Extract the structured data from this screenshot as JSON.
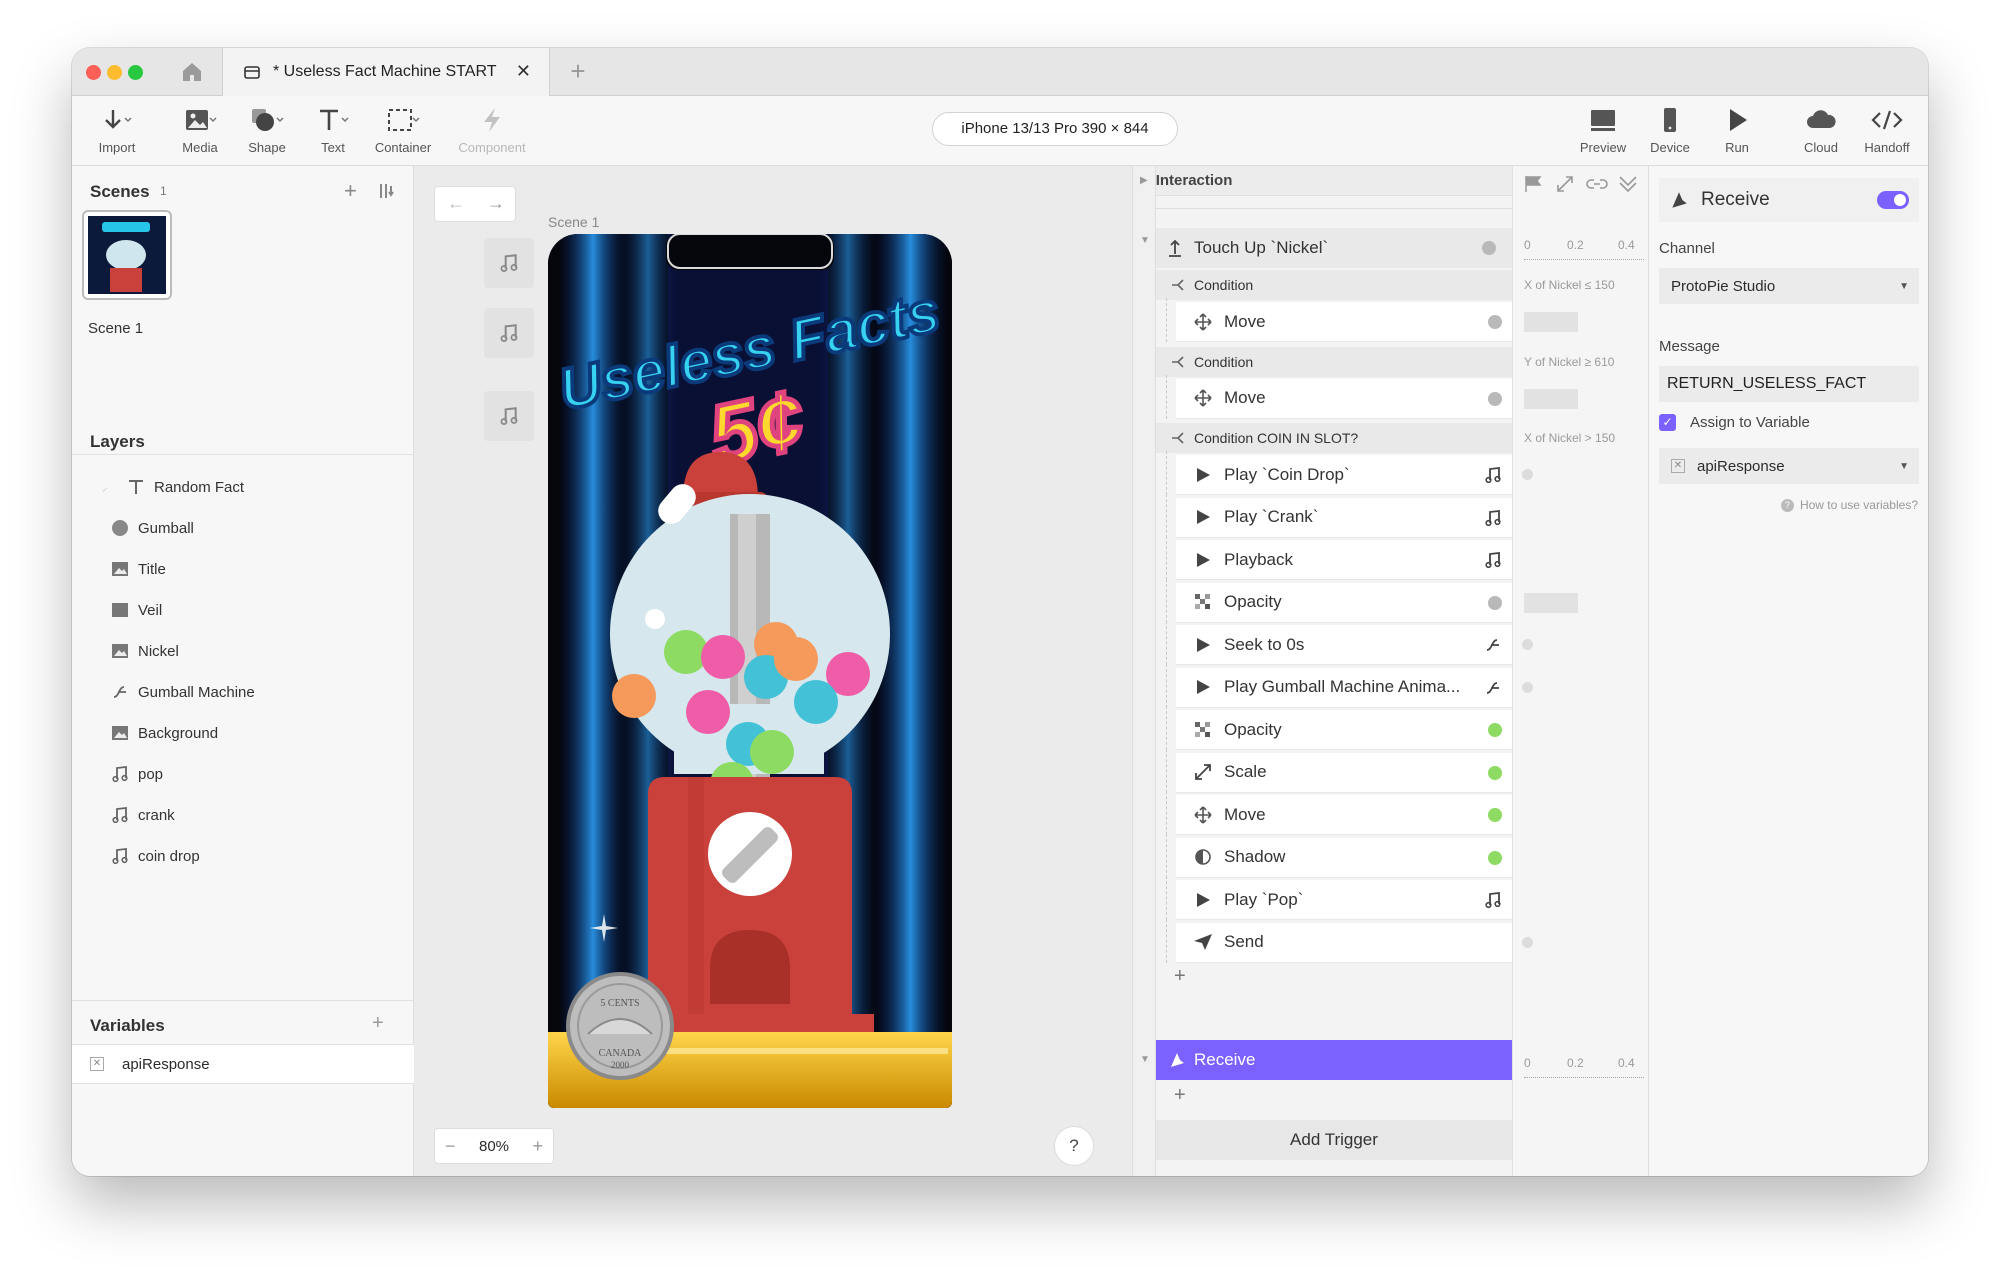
{
  "window": {
    "tab_title": "* Useless Fact Machine START",
    "traffic_lights": {
      "close": "#fe5f57",
      "minimize": "#febc2e",
      "zoom": "#28c840"
    }
  },
  "toolbar": {
    "left_tools": [
      {
        "label": "Import",
        "icon": "import-icon"
      },
      {
        "label": "Media",
        "icon": "media-icon"
      },
      {
        "label": "Shape",
        "icon": "shape-icon"
      },
      {
        "label": "Text",
        "icon": "text-icon"
      },
      {
        "label": "Container",
        "icon": "container-icon"
      },
      {
        "label": "Component",
        "icon": "component-icon"
      }
    ],
    "device": "iPhone 13/13 Pro  390 × 844",
    "right_tools": [
      {
        "label": "Preview",
        "icon": "preview-icon"
      },
      {
        "label": "Device",
        "icon": "device-icon"
      },
      {
        "label": "Run",
        "icon": "run-icon"
      },
      {
        "label": "Cloud",
        "icon": "cloud-icon"
      },
      {
        "label": "Handoff",
        "icon": "handoff-icon"
      }
    ]
  },
  "scenes": {
    "title": "Scenes",
    "count": "1",
    "items": [
      {
        "label": "Scene 1"
      }
    ]
  },
  "layers": {
    "title": "Layers",
    "items": [
      {
        "label": "Random Fact",
        "icon": "text-icon"
      },
      {
        "label": "Gumball",
        "icon": "circle-shape-icon"
      },
      {
        "label": "Title",
        "icon": "image-icon"
      },
      {
        "label": "Veil",
        "icon": "rectangle-shape-icon"
      },
      {
        "label": "Nickel",
        "icon": "image-icon"
      },
      {
        "label": "Gumball Machine",
        "icon": "lottie-icon"
      },
      {
        "label": "Background",
        "icon": "image-icon"
      },
      {
        "label": "pop",
        "icon": "music-note-icon"
      },
      {
        "label": "crank",
        "icon": "music-note-icon"
      },
      {
        "label": "coin drop",
        "icon": "music-note-icon"
      }
    ]
  },
  "variables": {
    "title": "Variables",
    "items": [
      {
        "label": "apiResponse"
      }
    ]
  },
  "canvas": {
    "scene_label": "Scene 1",
    "zoom": "80%",
    "help": "?",
    "artwork": {
      "title_line": "Useless Facts",
      "price": "5¢",
      "coin_text": "5 CENTS",
      "coin_country": "CANADA",
      "coin_year": "2000"
    }
  },
  "interaction": {
    "title": "Interaction",
    "trigger1": {
      "label": "Touch Up `Nickel`"
    },
    "rows": [
      {
        "type": "condition",
        "label": "Condition",
        "note": "X of Nickel ≤ 150"
      },
      {
        "type": "response",
        "label": "Move",
        "icon": "move-icon",
        "status": "gray",
        "bar": true
      },
      {
        "type": "condition",
        "label": "Condition",
        "note": "Y of Nickel ≥ 610"
      },
      {
        "type": "response",
        "label": "Move",
        "icon": "move-icon",
        "status": "gray",
        "bar": true
      },
      {
        "type": "condition",
        "label": "Condition COIN IN SLOT?",
        "note": "X of Nickel > 150"
      },
      {
        "type": "response",
        "label": "Play `Coin Drop`",
        "icon": "play-icon",
        "trailing": "music-note-icon",
        "tick": true
      },
      {
        "type": "response",
        "label": "Play `Crank`",
        "icon": "play-icon",
        "trailing": "music-note-icon"
      },
      {
        "type": "response",
        "label": "Playback",
        "icon": "play-icon",
        "trailing": "music-note-icon"
      },
      {
        "type": "response",
        "label": "Opacity",
        "icon": "opacity-icon",
        "status": "gray",
        "bar": true
      },
      {
        "type": "response",
        "label": "Seek to 0s",
        "icon": "play-icon",
        "trailing": "lottie-icon",
        "tick": true
      },
      {
        "type": "response",
        "label": "Play Gumball Machine Anima...",
        "icon": "play-icon",
        "trailing": "lottie-icon",
        "tick": true
      },
      {
        "type": "response",
        "label": "Opacity",
        "icon": "opacity-icon",
        "status": "green"
      },
      {
        "type": "response",
        "label": "Scale",
        "icon": "scale-icon",
        "status": "green"
      },
      {
        "type": "response",
        "label": "Move",
        "icon": "move-icon",
        "status": "green"
      },
      {
        "type": "response",
        "label": "Shadow",
        "icon": "shadow-icon",
        "status": "green"
      },
      {
        "type": "response",
        "label": "Play `Pop`",
        "icon": "play-icon",
        "trailing": "music-note-icon"
      },
      {
        "type": "response",
        "label": "Send",
        "icon": "send-icon",
        "tick": true
      }
    ],
    "trigger2": {
      "label": "Receive"
    },
    "add_trigger": "Add Trigger",
    "timeline_ticks": [
      "0",
      "0.2",
      "0.4"
    ]
  },
  "properties": {
    "title": "Receive",
    "toggle_on": true,
    "channel_label": "Channel",
    "channel_value": "ProtoPie Studio",
    "message_label": "Message",
    "message_value": "RETURN_USELESS_FACT",
    "assign_label": "Assign to Variable",
    "assign_checked": true,
    "variable_value": "apiResponse",
    "help_link": "How to use variables?"
  },
  "colors": {
    "accent": "#7b61ff",
    "green_status": "#8edb63",
    "gray_status": "#b9b9b9"
  }
}
